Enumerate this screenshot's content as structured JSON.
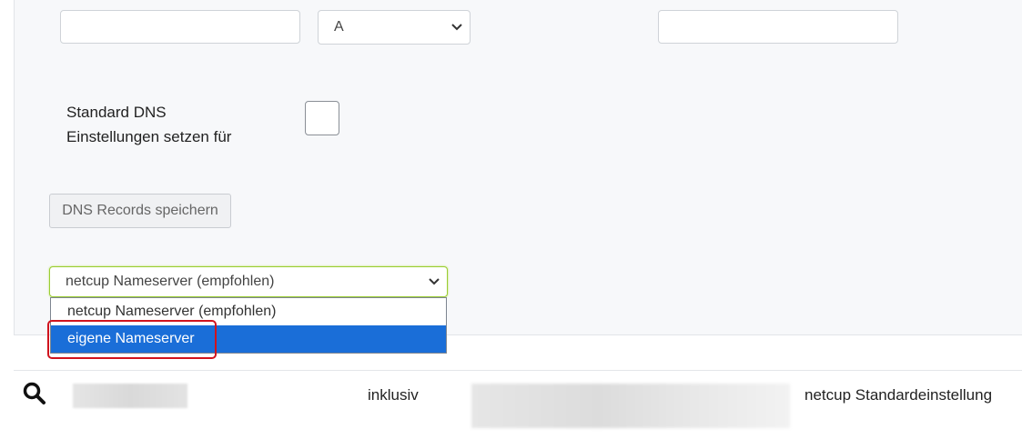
{
  "dns_record_row": {
    "type_select_value": "A"
  },
  "standard_dns": {
    "label_line1": "Standard DNS",
    "label_line2": "Einstellungen setzen für"
  },
  "save_button": {
    "label": "DNS Records speichern"
  },
  "nameserver_select": {
    "selected": "netcup Nameserver (empfohlen)",
    "options": [
      "netcup Nameserver (empfohlen)",
      "eigene Nameserver"
    ],
    "highlighted_option": "eigene Nameserver"
  },
  "table_row": {
    "col_inklusive": "inklusiv",
    "col_nameserver": "netcup Standardeinstellung"
  },
  "colors": {
    "accent_highlight": "#1a6ed8",
    "annotation_red": "#d0141e",
    "focus_green": "#9acd32"
  }
}
